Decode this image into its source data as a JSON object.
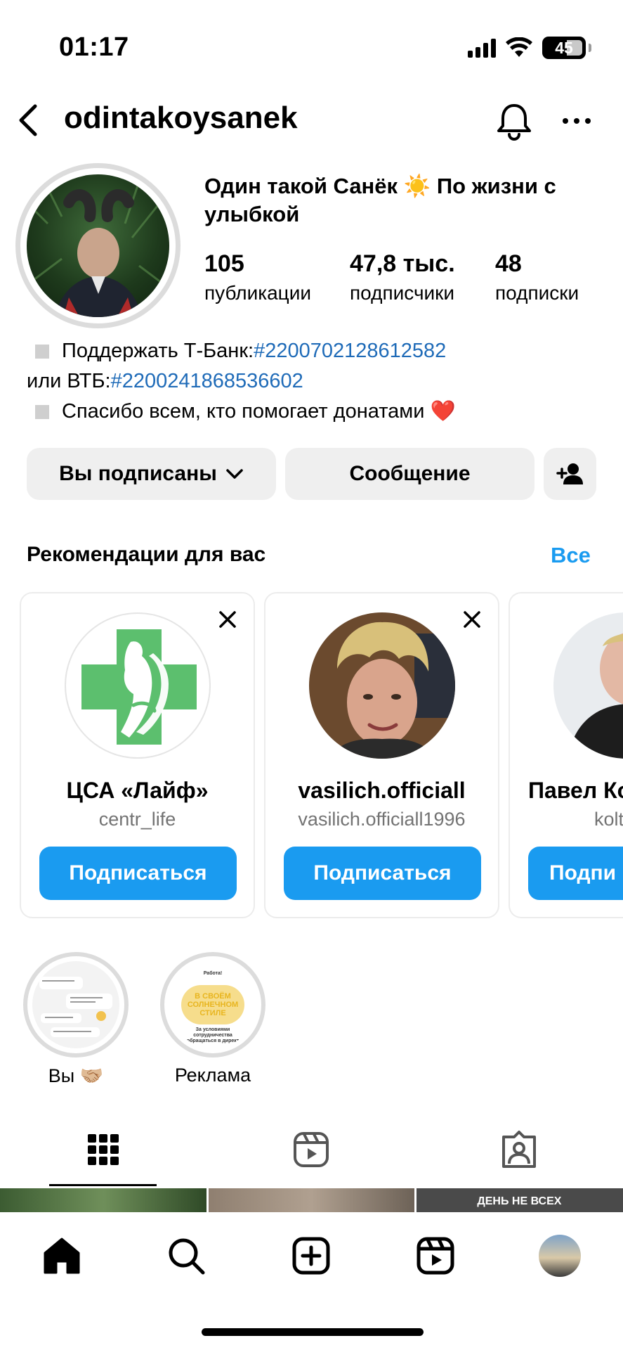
{
  "status_bar": {
    "time": "01:17",
    "battery": "45",
    "icons": [
      "signal-icon",
      "wifi-icon",
      "battery-icon"
    ]
  },
  "header": {
    "username": "odintakoysanek",
    "icons": [
      "back-arrow-icon",
      "bell-icon",
      "more-icon"
    ]
  },
  "profile": {
    "display_name": "Один такой Санёк ☀️ По жизни с улыбкой",
    "stats": [
      {
        "value": "105",
        "label": "публикации"
      },
      {
        "value": "47,8 тыс.",
        "label": "подписчики"
      },
      {
        "value": "48",
        "label": "подписки"
      }
    ],
    "bio": {
      "line1_text": "Поддержать Т-Банк: ",
      "line1_link": "#2200702128612582",
      "line2_text": "или ВТБ: ",
      "line2_link": "#2200241868536602",
      "line3_text": "Спасибо всем, кто помогает донатами ❤️"
    }
  },
  "actions": {
    "following_label": "Вы подписаны",
    "message_label": "Сообщение",
    "icons": [
      "chevron-down-icon",
      "add-person-icon"
    ]
  },
  "recommendations": {
    "title": "Рекомендации для вас",
    "see_all": "Все",
    "cards": [
      {
        "name": "ЦСА «Лайф»",
        "handle": "centr_life",
        "button": "Подписаться"
      },
      {
        "name": "vasilich.officiall",
        "handle": "vasilich.officiall1996",
        "button": "Подписаться"
      },
      {
        "name": "Павел Кол",
        "handle": "kolt",
        "button": "Подпи"
      }
    ]
  },
  "highlights": [
    {
      "label": "Вы 🤝🏼"
    },
    {
      "label": "Реклама",
      "cover": {
        "top": "Работа!",
        "middle": "В СВОЁМ СОЛНЕЧНОМ СТИЛЕ",
        "bottom": "За условиями сотрудничества обращаться в директ"
      }
    }
  ],
  "tabs": [
    "grid-icon",
    "reels-icon",
    "tagged-icon"
  ],
  "grid_preview_text": "ДЕНЬ НЕ ВСЕХ",
  "bottom_nav": [
    "home-icon",
    "search-icon",
    "create-icon",
    "reels-icon",
    "profile-avatar"
  ],
  "colors": {
    "accent": "#1a9bf0",
    "link": "#1f6bb8",
    "button_gray": "#efefef",
    "secondary_text": "#737373"
  }
}
